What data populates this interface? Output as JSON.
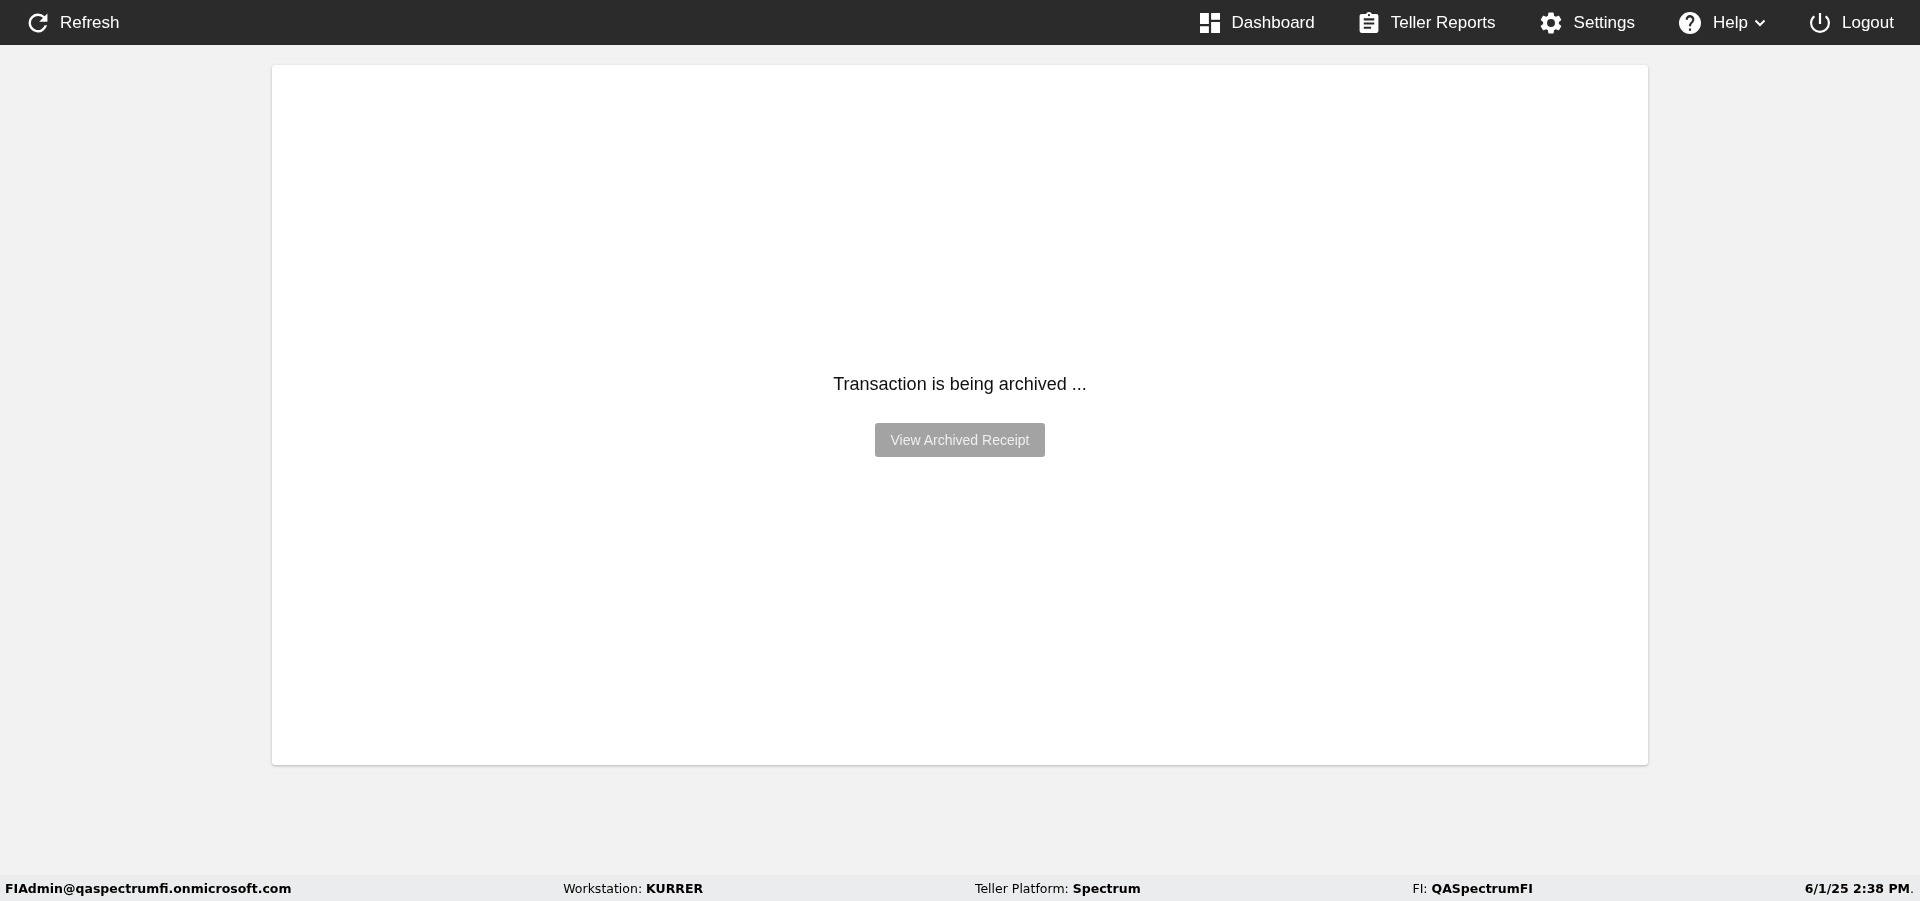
{
  "toolbar": {
    "left": [
      {
        "label": "Refresh"
      }
    ],
    "right": [
      {
        "label": "Dashboard",
        "dropdown": false
      },
      {
        "label": "Teller Reports",
        "dropdown": false
      },
      {
        "label": "Settings",
        "dropdown": false
      },
      {
        "label": "Help",
        "dropdown": true
      },
      {
        "label": "Logout",
        "dropdown": false
      }
    ]
  },
  "content": {
    "message": "Transaction is being archived ...",
    "button": {
      "label": "View Archived Receipt",
      "disabled": true
    }
  },
  "status_bar": [
    {
      "value": "FIAdmin@qaspectrumfi.onmicrosoft.com"
    },
    {
      "label": "Workstation:",
      "value": "KURRER"
    },
    {
      "label": "Teller Platform:",
      "value": "Spectrum"
    },
    {
      "label": "FI:",
      "value": "QASpectrumFI"
    },
    {
      "value": "6/1/25 2:38 PM",
      "suffix": "."
    }
  ]
}
